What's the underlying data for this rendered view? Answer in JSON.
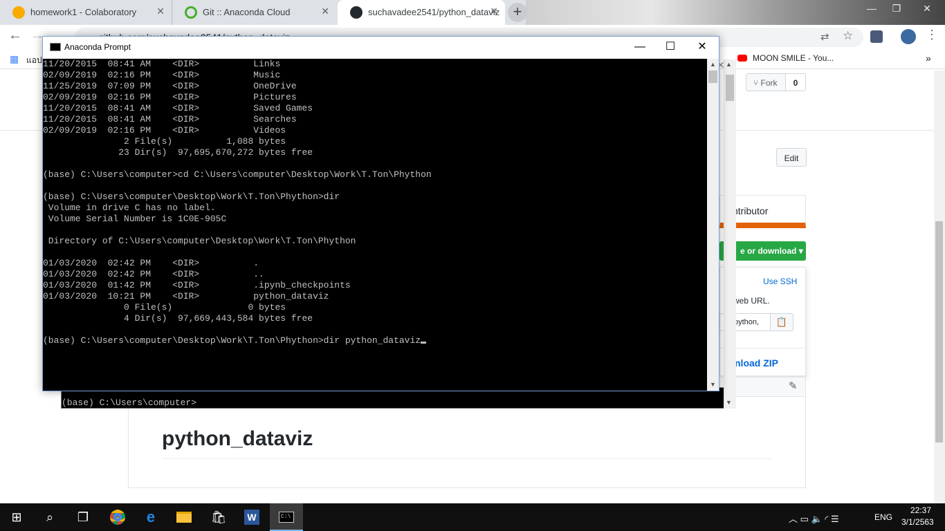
{
  "browser": {
    "tabs": [
      {
        "label": "homework1 - Colaboratory",
        "favicon_color": "#f9ab00"
      },
      {
        "label": "Git :: Anaconda Cloud",
        "favicon_color": "#43b02a"
      },
      {
        "label": "suchavadee2541/python_dataviz",
        "favicon_color": "#24292e"
      }
    ],
    "url": "github.com/suchavadee2541/python_dataviz",
    "bookmarks": {
      "apps_label": "แอป",
      "youtube_label": "MOON SMILE - You..."
    }
  },
  "github": {
    "fork_label": "Fork",
    "fork_count": "0",
    "edit_label": "Edit",
    "contributor_label": "ntributor",
    "clone_button": "e or download",
    "use_ssh": "Use SSH",
    "web_url_text": "web URL.",
    "clone_input_value": "python,",
    "download_zip": "nload ZIP",
    "readme_title": "python_dataviz",
    "accent": "#28a745",
    "language_bar_color": "#e36209"
  },
  "console": {
    "title": "Anaconda Prompt",
    "lines": [
      "11/20/2015  08:41 AM    <DIR>          Links",
      "02/09/2019  02:16 PM    <DIR>          Music",
      "11/25/2019  07:09 PM    <DIR>          OneDrive",
      "02/09/2019  02:16 PM    <DIR>          Pictures",
      "11/20/2015  08:41 AM    <DIR>          Saved Games",
      "11/20/2015  08:41 AM    <DIR>          Searches",
      "02/09/2019  02:16 PM    <DIR>          Videos",
      "               2 File(s)          1,088 bytes",
      "              23 Dir(s)  97,695,670,272 bytes free",
      "",
      "(base) C:\\Users\\computer>cd C:\\Users\\computer\\Desktop\\Work\\T.Ton\\Phython",
      "",
      "(base) C:\\Users\\computer\\Desktop\\Work\\T.Ton\\Phython>dir",
      " Volume in drive C has no label.",
      " Volume Serial Number is 1C0E-905C",
      "",
      " Directory of C:\\Users\\computer\\Desktop\\Work\\T.Ton\\Phython",
      "",
      "01/03/2020  02:42 PM    <DIR>          .",
      "01/03/2020  02:42 PM    <DIR>          ..",
      "01/03/2020  01:42 PM    <DIR>          .ipynb_checkpoints",
      "01/03/2020  10:21 PM    <DIR>          python_dataviz",
      "               0 File(s)              0 bytes",
      "               4 Dir(s)  97,669,443,584 bytes free",
      "",
      "(base) C:\\Users\\computer\\Desktop\\Work\\T.Ton\\Phython>dir python_dataviz"
    ],
    "background_prompt": "(base) C:\\Users\\computer>"
  },
  "taskbar": {
    "language": "ENG",
    "time": "22:37",
    "date": "3/1/2563"
  }
}
